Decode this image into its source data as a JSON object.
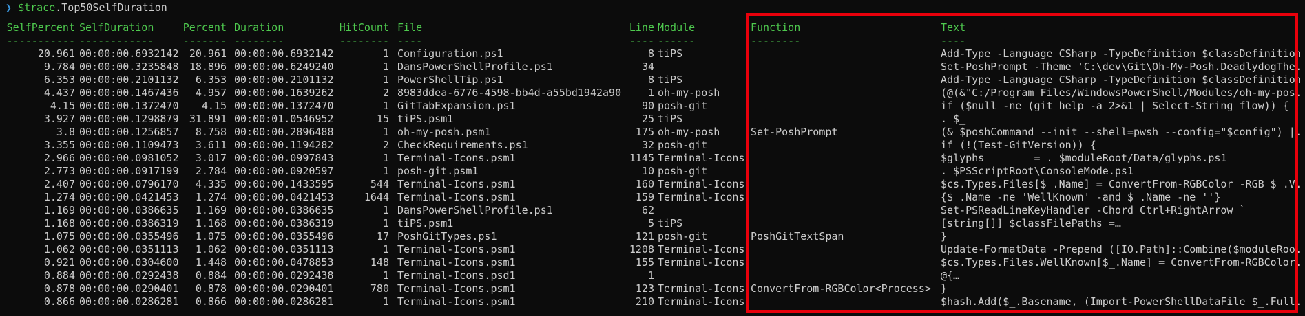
{
  "prompt": {
    "chevron": "❯",
    "variable": "$trace",
    "member": ".Top50SelfDuration"
  },
  "columns": [
    "SelfPercent",
    "SelfDuration",
    "Percent",
    "Duration",
    "HitCount",
    "File",
    "Line",
    "Module",
    "Function",
    "Text"
  ],
  "dashes": [
    "-----------",
    "------------",
    "-------",
    "--------",
    "--------",
    "----",
    "----",
    "------",
    "--------",
    "----"
  ],
  "rows": [
    [
      "20.961",
      "00:00:00.6932142",
      "20.961",
      "00:00:00.6932142",
      "1",
      "Configuration.ps1",
      "8",
      "tiPS",
      "",
      "Add-Type -Language CSharp -TypeDefinition $classDefinition"
    ],
    [
      "9.784",
      "00:00:00.3235848",
      "18.896",
      "00:00:00.6249240",
      "1",
      "DansPowerShellProfile.ps1",
      "34",
      "",
      "",
      "Set-PoshPrompt -Theme 'C:\\dev\\Git\\Oh-My-Posh.DeadlydogThe…"
    ],
    [
      "6.353",
      "00:00:00.2101132",
      "6.353",
      "00:00:00.2101132",
      "1",
      "PowerShellTip.ps1",
      "8",
      "tiPS",
      "",
      "Add-Type -Language CSharp -TypeDefinition $classDefinition"
    ],
    [
      "4.437",
      "00:00:00.1467436",
      "4.957",
      "00:00:00.1639262",
      "2",
      "8983ddea-6776-4598-bb4d-a55bd1942a90",
      "1",
      "oh-my-posh",
      "",
      "(@(&\"C:/Program Files/WindowsPowerShell/Modules/oh-my-pos…"
    ],
    [
      "4.15",
      "00:00:00.1372470",
      "4.15",
      "00:00:00.1372470",
      "1",
      "GitTabExpansion.ps1",
      "90",
      "posh-git",
      "",
      "if ($null -ne (git help -a 2>&1 | Select-String flow)) {"
    ],
    [
      "3.927",
      "00:00:00.1298879",
      "31.891",
      "00:00:01.0546952",
      "15",
      "tiPS.psm1",
      "25",
      "tiPS",
      "",
      ". $_"
    ],
    [
      "3.8",
      "00:00:00.1256857",
      "8.758",
      "00:00:00.2896488",
      "1",
      "oh-my-posh.psm1",
      "175",
      "oh-my-posh",
      "Set-PoshPrompt",
      "(& $poshCommand --init --shell=pwsh --config=\"$config\") |…"
    ],
    [
      "3.355",
      "00:00:00.1109473",
      "3.611",
      "00:00:00.1194282",
      "2",
      "CheckRequirements.ps1",
      "32",
      "posh-git",
      "",
      "if (!(Test-GitVersion)) {"
    ],
    [
      "2.966",
      "00:00:00.0981052",
      "3.017",
      "00:00:00.0997843",
      "1",
      "Terminal-Icons.psm1",
      "1145",
      "Terminal-Icons",
      "",
      "$glyphs        = . $moduleRoot/Data/glyphs.ps1"
    ],
    [
      "2.773",
      "00:00:00.0917199",
      "2.784",
      "00:00:00.0920597",
      "1",
      "posh-git.psm1",
      "10",
      "posh-git",
      "",
      ". $PSScriptRoot\\ConsoleMode.ps1"
    ],
    [
      "2.407",
      "00:00:00.0796170",
      "4.335",
      "00:00:00.1433595",
      "544",
      "Terminal-Icons.psm1",
      "160",
      "Terminal-Icons",
      "",
      "$cs.Types.Files[$_.Name] = ConvertFrom-RGBColor -RGB $_.V…"
    ],
    [
      "1.274",
      "00:00:00.0421453",
      "1.274",
      "00:00:00.0421453",
      "1644",
      "Terminal-Icons.psm1",
      "159",
      "Terminal-Icons",
      "",
      "{$_.Name -ne 'WellKnown' -and $_.Name -ne ''}"
    ],
    [
      "1.169",
      "00:00:00.0386635",
      "1.169",
      "00:00:00.0386635",
      "1",
      "DansPowerShellProfile.ps1",
      "62",
      "",
      "",
      "Set-PSReadLineKeyHandler -Chord Ctrl+RightArrow `"
    ],
    [
      "1.168",
      "00:00:00.0386319",
      "1.168",
      "00:00:00.0386319",
      "1",
      "tiPS.psm1",
      "5",
      "tiPS",
      "",
      "[string[]] $classFilePaths =…"
    ],
    [
      "1.075",
      "00:00:00.0355496",
      "1.075",
      "00:00:00.0355496",
      "17",
      "PoshGitTypes.ps1",
      "121",
      "posh-git",
      "PoshGitTextSpan",
      "}"
    ],
    [
      "1.062",
      "00:00:00.0351113",
      "1.062",
      "00:00:00.0351113",
      "1",
      "Terminal-Icons.psm1",
      "1208",
      "Terminal-Icons",
      "",
      "Update-FormatData -Prepend ([IO.Path]::Combine($moduleRoo…"
    ],
    [
      "0.921",
      "00:00:00.0304600",
      "1.448",
      "00:00:00.0478853",
      "148",
      "Terminal-Icons.psm1",
      "155",
      "Terminal-Icons",
      "",
      "$cs.Types.Files.WellKnown[$_.Name] = ConvertFrom-RGBColor…"
    ],
    [
      "0.884",
      "00:00:00.0292438",
      "0.884",
      "00:00:00.0292438",
      "1",
      "Terminal-Icons.psd1",
      "1",
      "",
      "",
      "@{…"
    ],
    [
      "0.878",
      "00:00:00.0290401",
      "0.878",
      "00:00:00.0290401",
      "780",
      "Terminal-Icons.psm1",
      "123",
      "Terminal-Icons",
      "ConvertFrom-RGBColor<Process>",
      "}"
    ],
    [
      "0.866",
      "00:00:00.0286281",
      "0.866",
      "00:00:00.0286281",
      "1",
      "Terminal-Icons.psm1",
      "210",
      "Terminal-Icons",
      "",
      "$hash.Add($_.Basename, (Import-PowerShellDataFile $_.Full…"
    ]
  ]
}
